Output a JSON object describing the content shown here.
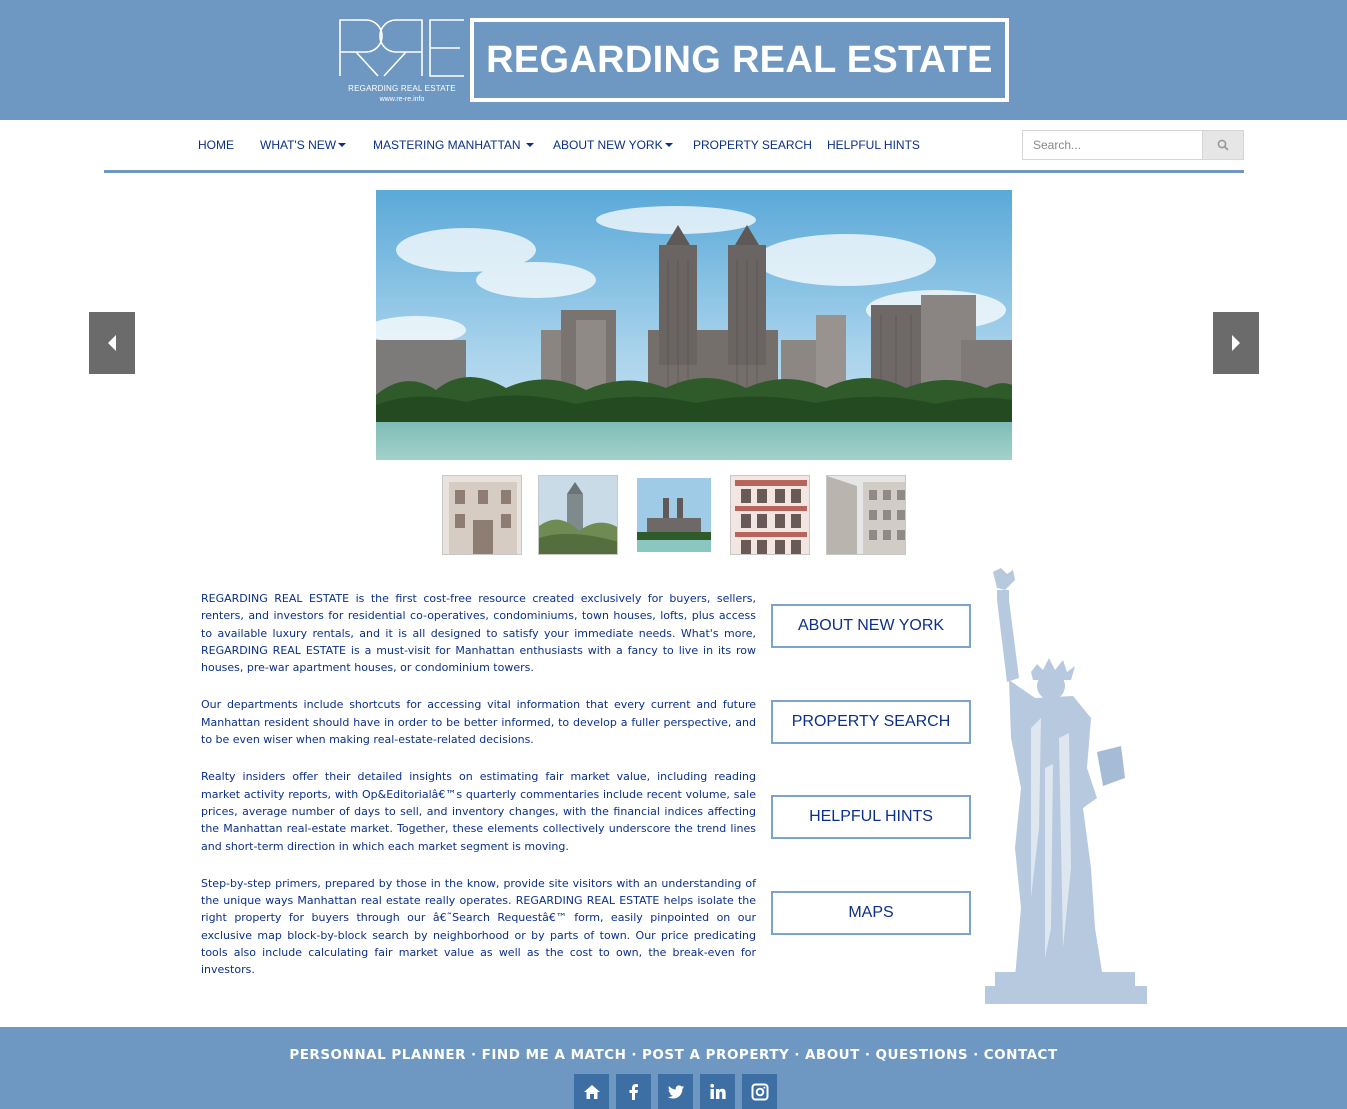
{
  "header": {
    "logo_line1": "REGARDING REAL ESTATE",
    "logo_line2": "www.re-re.info",
    "brand_title": "REGARDING REAL ESTATE"
  },
  "nav": {
    "items": [
      {
        "label": "HOME",
        "dropdown": false
      },
      {
        "label": "WHAT'S NEW",
        "dropdown": true
      },
      {
        "label": "MASTERING MANHATTAN",
        "dropdown": true
      },
      {
        "label": "ABOUT NEW YORK",
        "dropdown": true
      },
      {
        "label": "PROPERTY SEARCH",
        "dropdown": false
      },
      {
        "label": "HELPFUL HINTS",
        "dropdown": false
      }
    ],
    "search_placeholder": "Search..."
  },
  "content": {
    "paragraphs": [
      "REGARDING REAL ESTATE is the first cost-free resource created exclusively for buyers, sellers, renters, and investors for residential co-operatives, condominiums, town houses, lofts, plus access to available luxury rentals, and it is all designed to satisfy your immediate needs. What's more, REGARDING REAL ESTATE is a must-visit for Manhattan enthusiasts with a fancy to live in its row houses, pre-war apartment houses, or condominium towers.",
      "Our departments include shortcuts for accessing vital information that every current and future Manhattan resident should have in order to be better informed, to develop a fuller perspective, and to be even wiser when making real-estate-related decisions.",
      "Realty insiders offer their detailed insights on estimating fair market value, including reading market activity reports, with Op&Editorialâ€™s quarterly commentaries include recent volume, sale prices, average number of days to sell, and inventory changes, with the financial indices affecting the Manhattan real-estate market. Together, these elements collectively underscore the trend lines and short-term direction in which each market segment is moving.",
      "Step-by-step primers, prepared by those in the know, provide site visitors with an understanding of the unique ways Manhattan real estate really operates. REGARDING REAL ESTATE helps isolate the right property for buyers through our â€˜Search Requestâ€™ form, easily pinpointed on our exclusive map block-by-block search by neighborhood or by parts of town. Our price predicating tools also include calculating fair market value as well as the cost to own, the break-even for investors."
    ]
  },
  "cta": [
    {
      "label": "ABOUT NEW YORK"
    },
    {
      "label": "PROPERTY SEARCH"
    },
    {
      "label": "HELPFUL HINTS"
    },
    {
      "label": "MAPS"
    }
  ],
  "footer": {
    "links": [
      "PERSONNAL PLANNER",
      "FIND ME A MATCH",
      "POST A PROPERTY",
      "ABOUT",
      "QUESTIONS",
      "CONTACT"
    ],
    "separator": "·",
    "social_icons": [
      "home-icon",
      "facebook-icon",
      "twitter-icon",
      "linkedin-icon",
      "instagram-icon"
    ]
  },
  "colors": {
    "header_bg": "#6e98c2",
    "text": "#0b2f8a",
    "social_bg": "#3d6fa5",
    "arrow_bg": "#6b6b6b"
  }
}
